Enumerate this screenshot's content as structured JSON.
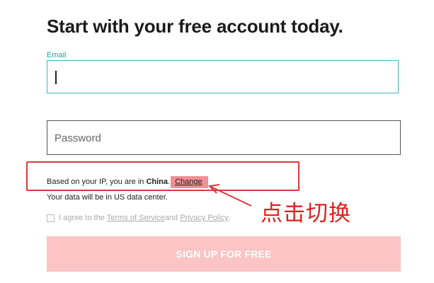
{
  "heading": "Start with your free account today.",
  "email": {
    "label": "Email",
    "value": ""
  },
  "password": {
    "placeholder": "Password"
  },
  "location": {
    "prefix": "Based on your IP, you are in ",
    "country": "China",
    "period": ".",
    "change_link": "Change",
    "datacenter_note": "Your data will be in US data center."
  },
  "agreement": {
    "prefix": "I agree to the ",
    "terms": "Terms of Service",
    "and": " and ",
    "privacy": "Privacy Policy",
    "suffix": "."
  },
  "signup_button": "SIGN UP FOR FREE",
  "annotation": "点击切换",
  "colors": {
    "accent_teal": "#40b4ba",
    "annotation_red": "#d93b3b",
    "button_pink": "#fcc4c4",
    "highlight": "#f08f95"
  }
}
